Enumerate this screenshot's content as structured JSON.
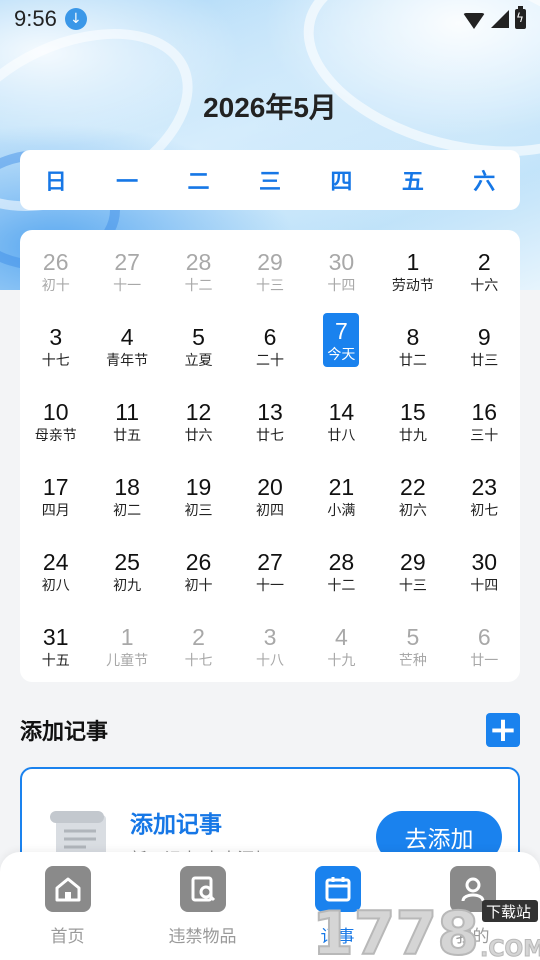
{
  "status_bar": {
    "time": "9:56"
  },
  "month_title": "2026年5月",
  "weekdays": [
    "日",
    "一",
    "二",
    "三",
    "四",
    "五",
    "六"
  ],
  "calendar": [
    {
      "day": "26",
      "lunar": "初十",
      "muted": true
    },
    {
      "day": "27",
      "lunar": "十一",
      "muted": true
    },
    {
      "day": "28",
      "lunar": "十二",
      "muted": true
    },
    {
      "day": "29",
      "lunar": "十三",
      "muted": true
    },
    {
      "day": "30",
      "lunar": "十四",
      "muted": true
    },
    {
      "day": "1",
      "lunar": "劳动节"
    },
    {
      "day": "2",
      "lunar": "十六"
    },
    {
      "day": "3",
      "lunar": "十七"
    },
    {
      "day": "4",
      "lunar": "青年节"
    },
    {
      "day": "5",
      "lunar": "立夏"
    },
    {
      "day": "6",
      "lunar": "二十"
    },
    {
      "day": "7",
      "lunar": "今天",
      "today": true
    },
    {
      "day": "8",
      "lunar": "廿二"
    },
    {
      "day": "9",
      "lunar": "廿三"
    },
    {
      "day": "10",
      "lunar": "母亲节"
    },
    {
      "day": "11",
      "lunar": "廿五"
    },
    {
      "day": "12",
      "lunar": "廿六"
    },
    {
      "day": "13",
      "lunar": "廿七"
    },
    {
      "day": "14",
      "lunar": "廿八"
    },
    {
      "day": "15",
      "lunar": "廿九"
    },
    {
      "day": "16",
      "lunar": "三十"
    },
    {
      "day": "17",
      "lunar": "四月"
    },
    {
      "day": "18",
      "lunar": "初二"
    },
    {
      "day": "19",
      "lunar": "初三"
    },
    {
      "day": "20",
      "lunar": "初四"
    },
    {
      "day": "21",
      "lunar": "小满"
    },
    {
      "day": "22",
      "lunar": "初六"
    },
    {
      "day": "23",
      "lunar": "初七"
    },
    {
      "day": "24",
      "lunar": "初八"
    },
    {
      "day": "25",
      "lunar": "初九"
    },
    {
      "day": "26",
      "lunar": "初十"
    },
    {
      "day": "27",
      "lunar": "十一"
    },
    {
      "day": "28",
      "lunar": "十二"
    },
    {
      "day": "29",
      "lunar": "十三"
    },
    {
      "day": "30",
      "lunar": "十四"
    },
    {
      "day": "31",
      "lunar": "十五"
    },
    {
      "day": "1",
      "lunar": "儿童节",
      "muted": true
    },
    {
      "day": "2",
      "lunar": "十七",
      "muted": true
    },
    {
      "day": "3",
      "lunar": "十八",
      "muted": true
    },
    {
      "day": "4",
      "lunar": "十九",
      "muted": true
    },
    {
      "day": "5",
      "lunar": "芒种",
      "muted": true
    },
    {
      "day": "6",
      "lunar": "廿一",
      "muted": true
    }
  ],
  "memo_section": {
    "title": "添加记事",
    "add_icon": "plus-icon",
    "card_title": "添加记事",
    "card_subtitle": "新五记事 点击添加",
    "button_label": "去添加"
  },
  "tabs": [
    {
      "label": "首页",
      "icon": "home-icon"
    },
    {
      "label": "违禁物品",
      "icon": "search-doc-icon"
    },
    {
      "label": "记事",
      "icon": "calendar-icon",
      "active": true
    },
    {
      "label": "我的",
      "icon": "person-icon"
    }
  ],
  "watermark": {
    "text": "1778",
    "domain": ".COM",
    "badge": "下载站"
  },
  "colors": {
    "accent": "#1a82ee",
    "muted_text": "#a8a8a8",
    "tab_inactive": "#8a8a8a"
  }
}
